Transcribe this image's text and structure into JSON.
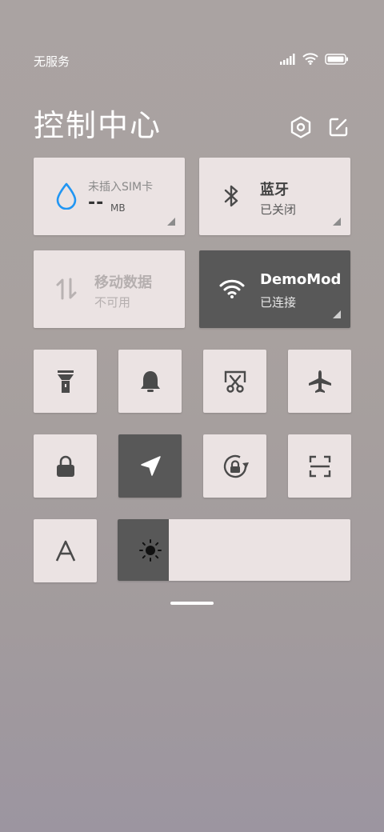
{
  "status_bar": {
    "carrier": "无服务",
    "icons": [
      "signal-icon",
      "wifi-icon",
      "battery-icon"
    ]
  },
  "header": {
    "title": "控制中心",
    "settings_icon": "hexagon-settings-icon",
    "edit_icon": "edit-icon"
  },
  "tiles": {
    "sim": {
      "label": "未插入SIM卡",
      "value": "--",
      "unit": "MB",
      "icon": "water-drop-icon",
      "accent": "#2196f3"
    },
    "bluetooth": {
      "title": "蓝牙",
      "status": "已关闭",
      "icon": "bluetooth-icon"
    },
    "mobile_data": {
      "title": "移动数据",
      "status": "不可用",
      "icon": "data-arrows-icon"
    },
    "wifi": {
      "title": "DemoMod",
      "status": "已连接",
      "icon": "wifi-icon"
    }
  },
  "toggles": [
    {
      "name": "flashlight",
      "icon": "flashlight-icon",
      "active": false
    },
    {
      "name": "ringer",
      "icon": "bell-icon",
      "active": false
    },
    {
      "name": "screenshot",
      "icon": "screenshot-scissors-icon",
      "active": false
    },
    {
      "name": "airplane",
      "icon": "airplane-icon",
      "active": false
    },
    {
      "name": "lock-screen",
      "icon": "lock-icon",
      "active": false
    },
    {
      "name": "location",
      "icon": "location-arrow-icon",
      "active": true
    },
    {
      "name": "rotation-lock",
      "icon": "rotation-lock-icon",
      "active": false
    },
    {
      "name": "scanner",
      "icon": "scan-icon",
      "active": false
    },
    {
      "name": "font-size",
      "icon": "font-a-icon",
      "active": false
    }
  ],
  "brightness": {
    "level": 0.22,
    "icon": "sun-icon"
  },
  "colors": {
    "tile_bg": "#ebe3e3",
    "tile_active": "#585858",
    "accent": "#2196f3"
  }
}
